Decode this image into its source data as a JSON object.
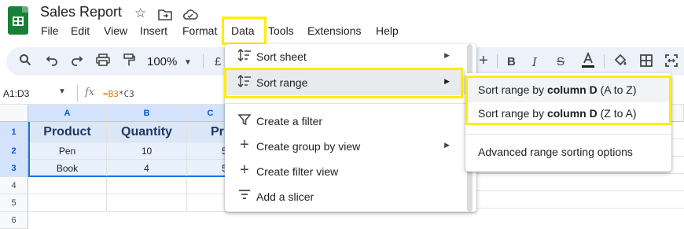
{
  "app": {
    "title": "Sales Report",
    "menu": [
      "File",
      "Edit",
      "View",
      "Insert",
      "Format",
      "Data",
      "Tools",
      "Extensions",
      "Help"
    ]
  },
  "toolbar": {
    "zoom": "100%",
    "currency": "£"
  },
  "formula_bar": {
    "name_box": "A1:D3",
    "fx": "fx",
    "formula_part1": "=B3",
    "formula_op": "*",
    "formula_part2": "C3"
  },
  "sheet": {
    "columns": [
      "A",
      "B",
      "C"
    ],
    "rows": [
      "1",
      "2",
      "3",
      "4",
      "5",
      "6"
    ],
    "headers": [
      "Product",
      "Quantity",
      "Pr"
    ],
    "data": [
      [
        "Pen",
        "10",
        "5"
      ],
      [
        "Book",
        "4",
        "5"
      ]
    ]
  },
  "data_menu": {
    "items": [
      {
        "label": "Sort sheet",
        "icon": "sort-icon",
        "submenu": true
      },
      {
        "label": "Sort range",
        "icon": "sort-icon",
        "submenu": true
      },
      {
        "label": "Create a filter",
        "icon": "filter-icon",
        "submenu": false
      },
      {
        "label": "Create group by view",
        "icon": "plus-icon",
        "submenu": true
      },
      {
        "label": "Create filter view",
        "icon": "plus-icon",
        "submenu": false
      },
      {
        "label": "Add a slicer",
        "icon": "slicer-icon",
        "submenu": false
      }
    ]
  },
  "sort_range_submenu": {
    "items": [
      {
        "prefix": "Sort range by ",
        "bold": "column D",
        "suffix": " (A to Z)"
      },
      {
        "prefix": "Sort range by ",
        "bold": "column D",
        "suffix": " (Z to A)"
      },
      {
        "label": "Advanced range sorting options"
      }
    ]
  },
  "colors": {
    "highlight": "#ffee00",
    "brand_green": "#188038",
    "selection": "#d3e3fd"
  }
}
